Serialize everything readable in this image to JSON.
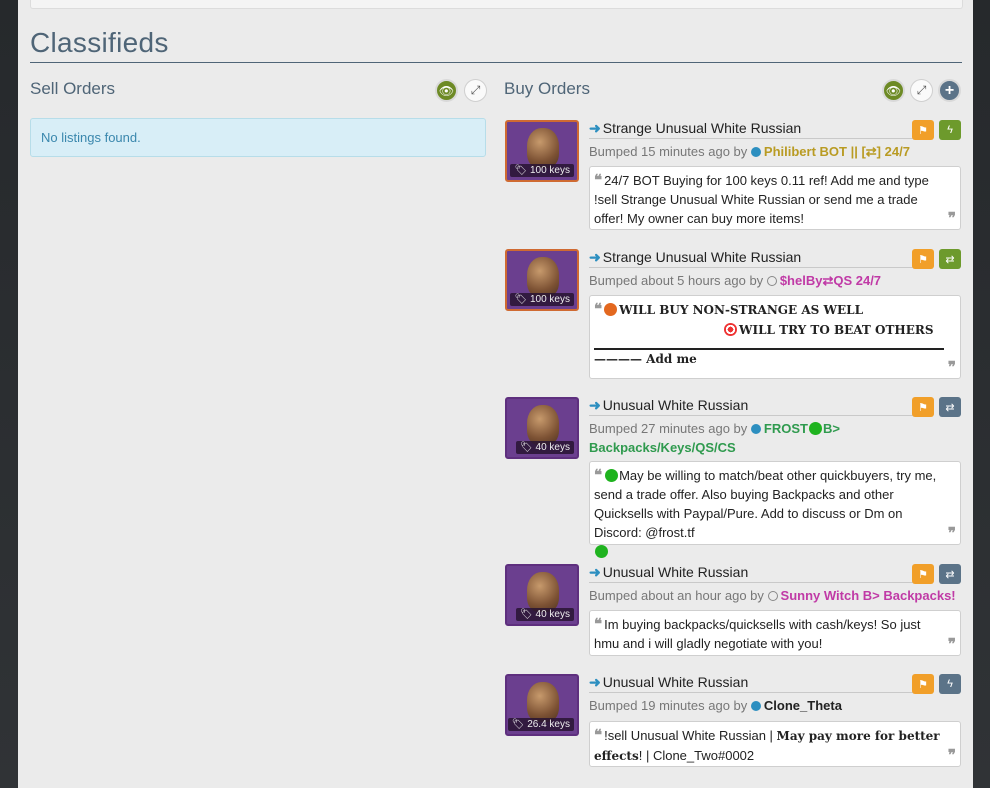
{
  "page_title": "Classifieds",
  "sell_orders": {
    "heading": "Sell Orders",
    "empty_message": "No listings found."
  },
  "buy_orders": {
    "heading": "Buy Orders",
    "listings": [
      {
        "title": "Strange Unusual White Russian",
        "price": "100 keys",
        "bumped": "Bumped 15 minutes ago by",
        "user": "Philibert BOT || [⇄] 24/7",
        "user_color": "#b99b23",
        "quote": "24/7 BOT Buying for 100 keys 0.11 ref! Add me and type !sell Strange Unusual White Russian or send me a trade offer! My owner can buy more items!"
      },
      {
        "title": "Strange Unusual White Russian",
        "price": "100 keys",
        "bumped": "Bumped about 5 hours ago by",
        "user": "$helBy⇄QS 24/7",
        "user_color": "#c03aa6",
        "quote_line1": "WILL BUY NON-STRANGE AS WELL",
        "quote_line2": "WILL TRY TO BEAT OTHERS",
        "quote_line3": "———— Add me"
      },
      {
        "title": "Unusual White Russian",
        "price": "40 keys",
        "bumped": "Bumped 27 minutes ago by",
        "user_a": "FROST",
        "user_b": "B>",
        "user_c": "Backpacks/Keys/QS/CS",
        "user_color": "#2f9a4e",
        "quote": "May be willing to match/beat other quickbuyers, try me, send a trade offer. Also buying Backpacks and other Quicksells with Paypal/Pure. Add to discuss or Dm on Discord: @frost.tf"
      },
      {
        "title": "Unusual White Russian",
        "price": "40 keys",
        "bumped": "Bumped about an hour ago by",
        "user": "Sunny Witch B> Backpacks!",
        "user_color": "#c03aa6",
        "quote": "Im buying backpacks/quicksells with cash/keys! So just hmu and i will gladly negotiate with you!"
      },
      {
        "title": "Unusual White Russian",
        "price": "26.4 keys",
        "bumped": "Bumped 19 minutes ago by",
        "user": "Clone_Theta",
        "user_color": "#222222",
        "quote_a": "!sell Unusual White Russian | ",
        "quote_b": "May pay more for better effects",
        "quote_c": "! | Clone_Two#0002"
      }
    ]
  },
  "icons": {
    "eye_slash": "👁",
    "expand": "⤢",
    "plus": "+",
    "flag": "⚑",
    "bolt": "ϟ",
    "exchange": "⇄",
    "arrow_left": "🡄",
    "quote_open": "❝",
    "quote_close": "❞"
  }
}
